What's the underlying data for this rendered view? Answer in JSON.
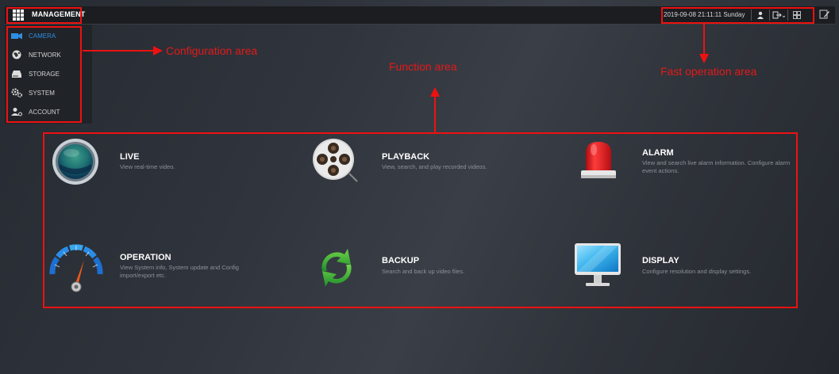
{
  "topbar": {
    "title": "MANAGEMENT",
    "datetime": "2019-09-08 21:11:11 Sunday"
  },
  "sidebar": {
    "items": [
      {
        "label": "CAMERA",
        "icon": "camera-icon",
        "active": true
      },
      {
        "label": "NETWORK",
        "icon": "network-globe-icon",
        "active": false
      },
      {
        "label": "STORAGE",
        "icon": "storage-icon",
        "active": false
      },
      {
        "label": "SYSTEM",
        "icon": "gears-icon",
        "active": false
      },
      {
        "label": "ACCOUNT",
        "icon": "account-icon",
        "active": false
      }
    ]
  },
  "annotations": {
    "configuration_area": "Configuration area",
    "function_area": "Function area",
    "fast_operation_area": "Fast operation area"
  },
  "functions": [
    {
      "title": "LIVE",
      "desc": "View real-time video.",
      "icon": "live-lens-icon"
    },
    {
      "title": "PLAYBACK",
      "desc": "View, search, and play recorded videos.",
      "icon": "film-reel-icon"
    },
    {
      "title": "ALARM",
      "desc": "View and search live alarm information. Configure alarm event actions.",
      "icon": "alarm-siren-icon"
    },
    {
      "title": "OPERATION",
      "desc": "View System info, System update and Config import/export etc.",
      "icon": "gauge-icon"
    },
    {
      "title": "BACKUP",
      "desc": "Search and back up video files.",
      "icon": "refresh-arrows-icon"
    },
    {
      "title": "DISPLAY",
      "desc": "Configure resolution and display settings.",
      "icon": "monitor-icon"
    }
  ],
  "colors": {
    "annotation_red": "#e11111",
    "active_blue": "#2f8ee0"
  }
}
